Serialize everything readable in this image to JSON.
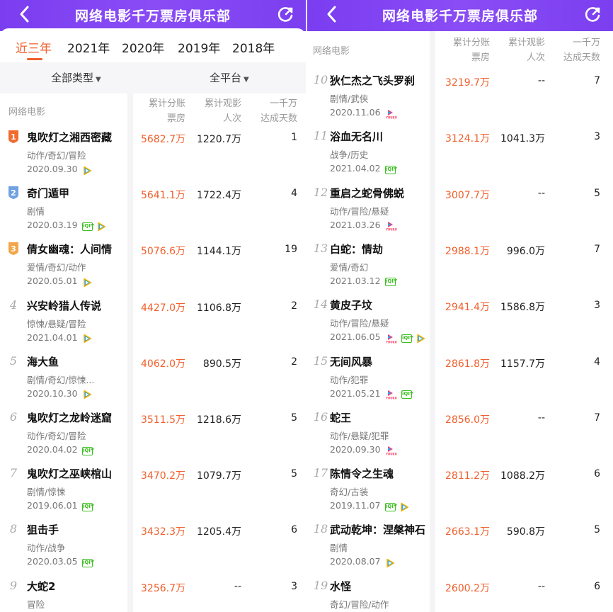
{
  "colors": {
    "header": "#7b3fef",
    "accent": "#f0602c",
    "iqiyi": "#3cbf20"
  },
  "left": {
    "header": {
      "title": "网络电影千万票房俱乐部",
      "back_icon": "chevron-left-icon",
      "share_icon": "refresh-share-icon"
    },
    "year_tabs": [
      "近三年",
      "2021年",
      "2020年",
      "2019年",
      "2018年"
    ],
    "active_year": "近三年",
    "filters": {
      "type": "全部类型",
      "platform": "全平台"
    },
    "columns": {
      "category": "网络电影",
      "box_1": "累计分账",
      "box_2": "票房",
      "views_1": "累计观影",
      "views_2": "人次",
      "days_1": "一千万",
      "days_2": "达成天数"
    },
    "rows": [
      {
        "rank": "1",
        "name": "鬼吹灯之湘西密藏",
        "genre": "动作/奇幻/冒险",
        "date": "2020.09.30",
        "box": "5682.7万",
        "views": "1220.7万",
        "days": "1",
        "platforms": [
          "tencent"
        ]
      },
      {
        "rank": "2",
        "name": "奇门遁甲",
        "genre": "剧情",
        "date": "2020.03.19",
        "box": "5641.1万",
        "views": "1722.4万",
        "days": "4",
        "platforms": [
          "iqiyi",
          "tencent"
        ]
      },
      {
        "rank": "3",
        "name": "倩女幽魂：人间情",
        "genre": "爱情/奇幻/动作",
        "date": "2020.05.01",
        "box": "5076.6万",
        "views": "1144.1万",
        "days": "19",
        "platforms": [
          "tencent"
        ]
      },
      {
        "rank": "4",
        "name": "兴安岭猎人传说",
        "genre": "惊悚/悬疑/冒险",
        "date": "2021.04.01",
        "box": "4427.0万",
        "views": "1106.8万",
        "days": "2",
        "platforms": [
          "tencent"
        ]
      },
      {
        "rank": "5",
        "name": "海大鱼",
        "genre": "剧情/奇幻/惊悚...",
        "date": "2020.10.30",
        "box": "4062.0万",
        "views": "890.5万",
        "days": "2",
        "platforms": [
          "tencent"
        ]
      },
      {
        "rank": "6",
        "name": "鬼吹灯之龙岭迷窟",
        "genre": "动作/奇幻/冒险",
        "date": "2020.04.02",
        "box": "3511.5万",
        "views": "1218.6万",
        "days": "5",
        "platforms": [
          "iqiyi"
        ]
      },
      {
        "rank": "7",
        "name": "鬼吹灯之巫峡棺山",
        "genre": "剧情/惊悚",
        "date": "2019.06.01",
        "box": "3470.2万",
        "views": "1079.7万",
        "days": "5",
        "platforms": [
          "iqiyi"
        ]
      },
      {
        "rank": "8",
        "name": "狙击手",
        "genre": "动作/战争",
        "date": "2020.03.05",
        "box": "3432.3万",
        "views": "1205.4万",
        "days": "6",
        "platforms": [
          "iqiyi"
        ]
      },
      {
        "rank": "9",
        "name": "大蛇2",
        "genre": "冒险",
        "date": "",
        "box": "3256.7万",
        "views": "--",
        "days": "3",
        "platforms": []
      }
    ]
  },
  "right": {
    "header": {
      "title": "网络电影千万票房俱乐部",
      "back_icon": "chevron-left-icon",
      "share_icon": "refresh-share-icon"
    },
    "columns": {
      "category": "网络电影",
      "box_1": "累计分账",
      "box_2": "票房",
      "views_1": "累计观影",
      "views_2": "人次",
      "days_1": "一千万",
      "days_2": "达成天数"
    },
    "rows": [
      {
        "rank": "10",
        "name": "狄仁杰之飞头罗刹",
        "genre": "剧情/武侠",
        "date": "2020.11.06",
        "box": "3219.7万",
        "views": "--",
        "days": "7",
        "platforms": [
          "youku"
        ]
      },
      {
        "rank": "11",
        "name": "浴血无名川",
        "genre": "战争/历史",
        "date": "2021.04.02",
        "box": "3124.1万",
        "views": "1041.3万",
        "days": "3",
        "platforms": [
          "iqiyi"
        ]
      },
      {
        "rank": "12",
        "name": "重启之蛇骨佛蜕",
        "genre": "动作/冒险/悬疑",
        "date": "2021.03.26",
        "box": "3007.7万",
        "views": "--",
        "days": "5",
        "platforms": [
          "youku"
        ]
      },
      {
        "rank": "13",
        "name": "白蛇：情劫",
        "genre": "爱情/奇幻",
        "date": "2021.03.12",
        "box": "2988.1万",
        "views": "996.0万",
        "days": "7",
        "platforms": [
          "iqiyi"
        ]
      },
      {
        "rank": "14",
        "name": "黄皮子坟",
        "genre": "动作/冒险/悬疑",
        "date": "2021.06.05",
        "box": "2941.4万",
        "views": "1586.8万",
        "days": "3",
        "platforms": [
          "youku",
          "iqiyi",
          "tencent"
        ]
      },
      {
        "rank": "15",
        "name": "无间风暴",
        "genre": "动作/犯罪",
        "date": "2021.05.21",
        "box": "2861.8万",
        "views": "1157.7万",
        "days": "4",
        "platforms": [
          "youku",
          "iqiyi"
        ]
      },
      {
        "rank": "16",
        "name": "蛇王",
        "genre": "动作/悬疑/犯罪",
        "date": "2020.09.30",
        "box": "2856.0万",
        "views": "--",
        "days": "7",
        "platforms": [
          "youku"
        ]
      },
      {
        "rank": "17",
        "name": "陈情令之生魂",
        "genre": "奇幻/古装",
        "date": "2019.11.07",
        "box": "2811.2万",
        "views": "1088.2万",
        "days": "6",
        "platforms": [
          "iqiyi",
          "tencent"
        ]
      },
      {
        "rank": "18",
        "name": "武动乾坤：涅槃神石",
        "genre": "剧情",
        "date": "2020.08.07",
        "box": "2663.1万",
        "views": "590.8万",
        "days": "5",
        "platforms": [
          "tencent"
        ]
      },
      {
        "rank": "19",
        "name": "水怪",
        "genre": "奇幻/冒险/动作",
        "date": "",
        "box": "2600.2万",
        "views": "--",
        "days": "6",
        "platforms": []
      }
    ]
  }
}
